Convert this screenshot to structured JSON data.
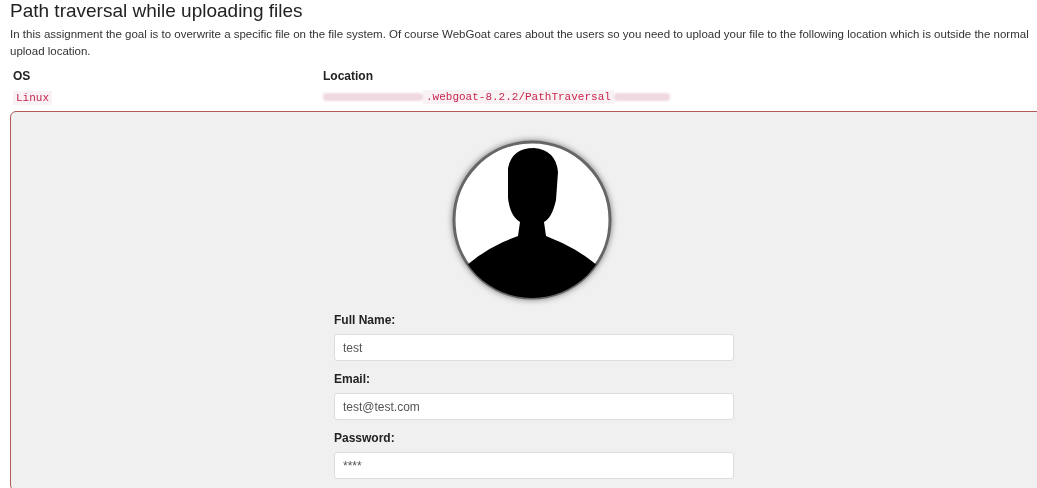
{
  "title": "Path traversal while uploading files",
  "intro": "In this assignment the goal is to overwrite a specific file on the file system. Of course WebGoat cares about the users so you need to upload your file to the following location which is outside the normal upload location.",
  "table": {
    "columns": [
      "OS",
      "Location"
    ],
    "rows": [
      [
        "Linux",
        ".webgoat-8.2.2/PathTraversal"
      ]
    ]
  },
  "form": {
    "fields": [
      {
        "label": "Full Name:",
        "value": "test"
      },
      {
        "label": "Email:",
        "value": "test@test.com"
      },
      {
        "label": "Password:",
        "value": "****"
      }
    ]
  }
}
